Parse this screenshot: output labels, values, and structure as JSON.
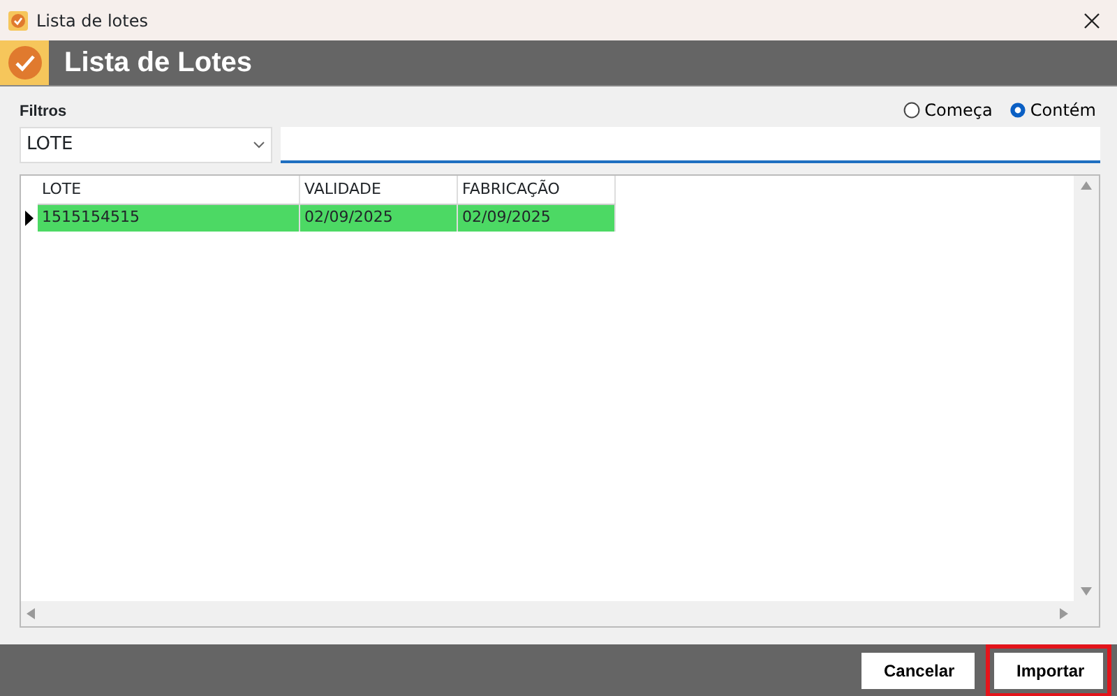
{
  "window": {
    "title": "Lista de lotes"
  },
  "header": {
    "title": "Lista de Lotes"
  },
  "filters": {
    "label": "Filtros",
    "field": "LOTE",
    "match_modes": [
      {
        "label": "Começa",
        "selected": false
      },
      {
        "label": "Contém",
        "selected": true
      }
    ]
  },
  "table": {
    "columns": [
      "LOTE",
      "VALIDADE",
      "FABRICAÇÃO"
    ],
    "rows": [
      {
        "cells": [
          "1515154515",
          "02/09/2025",
          "02/09/2025"
        ],
        "selected": true
      }
    ]
  },
  "buttons": [
    {
      "label": "Cancelar",
      "highlighted": false
    },
    {
      "label": "Importar",
      "highlighted": true
    }
  ]
}
